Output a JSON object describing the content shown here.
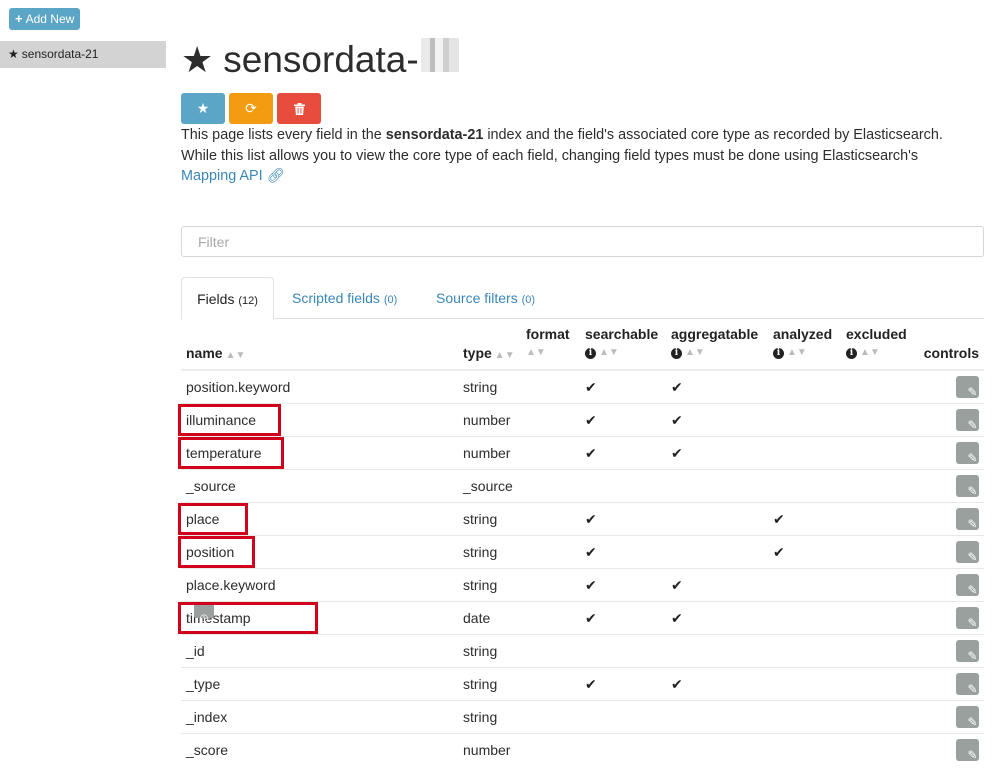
{
  "sidebar": {
    "add_new_label": "Add New",
    "index_item_label": "sensordata-21"
  },
  "header": {
    "title": "sensordata-"
  },
  "description": {
    "line_prefix": "This page lists every field in the ",
    "index_name": "sensordata-21",
    "line_suffix": " index and the field's associated core type as recorded by Elasticsearch. While this list allows you to view the core type of each field, changing field types must be done using Elasticsearch's",
    "link_label": "Mapping API"
  },
  "filter": {
    "placeholder": "Filter"
  },
  "tabs": [
    {
      "label": "Fields",
      "count": "(12)"
    },
    {
      "label": "Scripted fields",
      "count": "(0)"
    },
    {
      "label": "Source filters",
      "count": "(0)"
    }
  ],
  "columns": {
    "name": "name",
    "type": "type",
    "format": "format",
    "searchable": "searchable",
    "aggregatable": "aggregatable",
    "analyzed": "analyzed",
    "excluded": "excluded",
    "controls": "controls"
  },
  "rows": [
    {
      "name": "position.keyword",
      "type": "string",
      "searchable": "✔",
      "aggregatable": "✔",
      "analyzed": ""
    },
    {
      "name": "illuminance",
      "type": "number",
      "searchable": "✔",
      "aggregatable": "✔",
      "analyzed": ""
    },
    {
      "name": "temperature",
      "type": "number",
      "searchable": "✔",
      "aggregatable": "✔",
      "analyzed": ""
    },
    {
      "name": "_source",
      "type": "_source",
      "searchable": "",
      "aggregatable": "",
      "analyzed": ""
    },
    {
      "name": "place",
      "type": "string",
      "searchable": "✔",
      "aggregatable": "",
      "analyzed": "✔"
    },
    {
      "name": "position",
      "type": "string",
      "searchable": "✔",
      "aggregatable": "",
      "analyzed": "✔"
    },
    {
      "name": "place.keyword",
      "type": "string",
      "searchable": "✔",
      "aggregatable": "✔",
      "analyzed": ""
    },
    {
      "name": "timestamp",
      "type": "date",
      "searchable": "✔",
      "aggregatable": "✔",
      "analyzed": ""
    },
    {
      "name": "_id",
      "type": "string",
      "searchable": "",
      "aggregatable": "",
      "analyzed": ""
    },
    {
      "name": "_type",
      "type": "string",
      "searchable": "✔",
      "aggregatable": "✔",
      "analyzed": ""
    },
    {
      "name": "_index",
      "type": "string",
      "searchable": "",
      "aggregatable": "",
      "analyzed": ""
    },
    {
      "name": "_score",
      "type": "number",
      "searchable": "",
      "aggregatable": "",
      "analyzed": ""
    }
  ],
  "icons": {
    "edit": "pencil-icon",
    "favorite": "star-icon",
    "refresh": "refresh-icon",
    "delete": "trash-icon",
    "info": "info-icon",
    "link": "link-icon",
    "date_badge": "clock-icon"
  },
  "colors": {
    "accent": "#5ba5c6",
    "refresh": "#f39c12",
    "delete": "#e74c3c",
    "highlight": "#d0021b",
    "link": "#3a87b5"
  }
}
